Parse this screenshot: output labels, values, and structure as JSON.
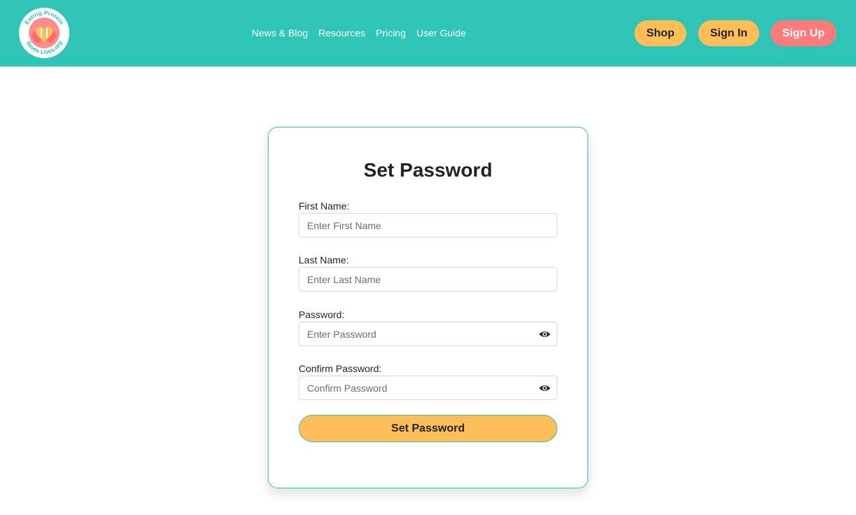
{
  "brand": {
    "logo_text_top": "Eating Protein",
    "logo_text_bottom": "Saves Lives.org",
    "colors": {
      "header": "#2ec4b6",
      "accent_yellow": "#ffbe57",
      "accent_coral": "#ff7a7a"
    }
  },
  "nav": {
    "items": [
      {
        "label": "News & Blog"
      },
      {
        "label": "Resources"
      },
      {
        "label": "Pricing"
      },
      {
        "label": "User Guide"
      }
    ]
  },
  "header_buttons": {
    "shop": "Shop",
    "sign_in": "Sign In",
    "sign_up": "Sign Up"
  },
  "form": {
    "title": "Set Password",
    "first_name": {
      "label": "First Name:",
      "placeholder": "Enter First Name",
      "value": ""
    },
    "last_name": {
      "label": "Last Name:",
      "placeholder": "Enter Last Name",
      "value": ""
    },
    "password": {
      "label": "Password:",
      "placeholder": "Enter Password",
      "value": "",
      "icon": "eye-icon"
    },
    "confirm_password": {
      "label": "Confirm Password:",
      "placeholder": "Confirm Password",
      "value": "",
      "icon": "eye-icon"
    },
    "submit_label": "Set Password"
  }
}
